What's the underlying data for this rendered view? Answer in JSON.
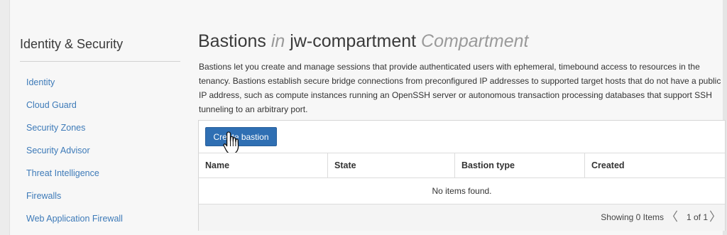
{
  "sidebar": {
    "title": "Identity & Security",
    "items": [
      {
        "label": "Identity"
      },
      {
        "label": "Cloud Guard"
      },
      {
        "label": "Security Zones"
      },
      {
        "label": "Security Advisor"
      },
      {
        "label": "Threat Intelligence"
      },
      {
        "label": "Firewalls"
      },
      {
        "label": "Web Application Firewall"
      }
    ]
  },
  "main": {
    "title_prefix": "Bastions",
    "title_in": "in",
    "title_compartment": "jw-compartment",
    "title_suffix": "Compartment",
    "description": "Bastions let you create and manage sessions that provide authenticated users with ephemeral, timebound access to resources in the tenancy. Bastions establish secure bridge connections from preconfigured IP addresses to supported target hosts that do not have a public IP address, such as compute instances running an OpenSSH server or autonomous transaction processing databases that support SSH tunneling to an arbitrary port.",
    "create_button_label": "Create bastion"
  },
  "table": {
    "columns": [
      "Name",
      "State",
      "Bastion type",
      "Created"
    ],
    "empty_text": "No items found."
  },
  "footer": {
    "showing": "Showing 0 Items",
    "page_info": "1 of 1",
    "prev_symbol": "〈",
    "next_symbol": "〉"
  },
  "colors": {
    "accent": "#2f6fb3",
    "link": "#3d7ab8"
  },
  "icons": {
    "cursor": "hand-pointer-icon"
  }
}
